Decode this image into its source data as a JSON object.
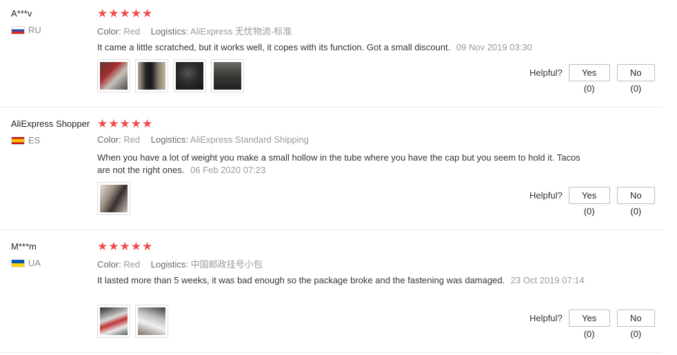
{
  "labels": {
    "color_key": "Color:",
    "logistics_key": "Logistics:",
    "helpful": "Helpful?",
    "stars": "★★★★★"
  },
  "reviews": [
    {
      "user": "A***v",
      "country": "RU",
      "rating": 5,
      "color": "Red",
      "logistics": "AliExpress 无忧物流-标准",
      "text": "It came a little scratched, but it works well, it copes with its function. Got a small discount.",
      "date": "09 Nov 2019 03:30",
      "photos": 4,
      "yes_label": "Yes (0)",
      "no_label": "No (0)"
    },
    {
      "user": "AliExpress Shopper",
      "country": "ES",
      "rating": 5,
      "color": "Red",
      "logistics": "AliExpress Standard Shipping",
      "text": "When you have a lot of weight you make a small hollow in the tube where you have the cap but you seem to hold it. Tacos are not the right ones.",
      "date": "06 Feb 2020 07:23",
      "photos": 1,
      "yes_label": "Yes (0)",
      "no_label": "No (0)"
    },
    {
      "user": "M***m",
      "country": "UA",
      "rating": 5,
      "color": "Red",
      "logistics": "中国邮政挂号小包",
      "text": "It lasted more than 5 weeks, it was bad enough so the package broke and the fastening was damaged.",
      "date": "23 Oct 2019 07:14",
      "photos": 2,
      "yes_label": "Yes (0)",
      "no_label": "No (0)"
    }
  ],
  "colors": {
    "star": "#f04a4a",
    "muted": "#999999",
    "divider": "#e8e8e8"
  }
}
